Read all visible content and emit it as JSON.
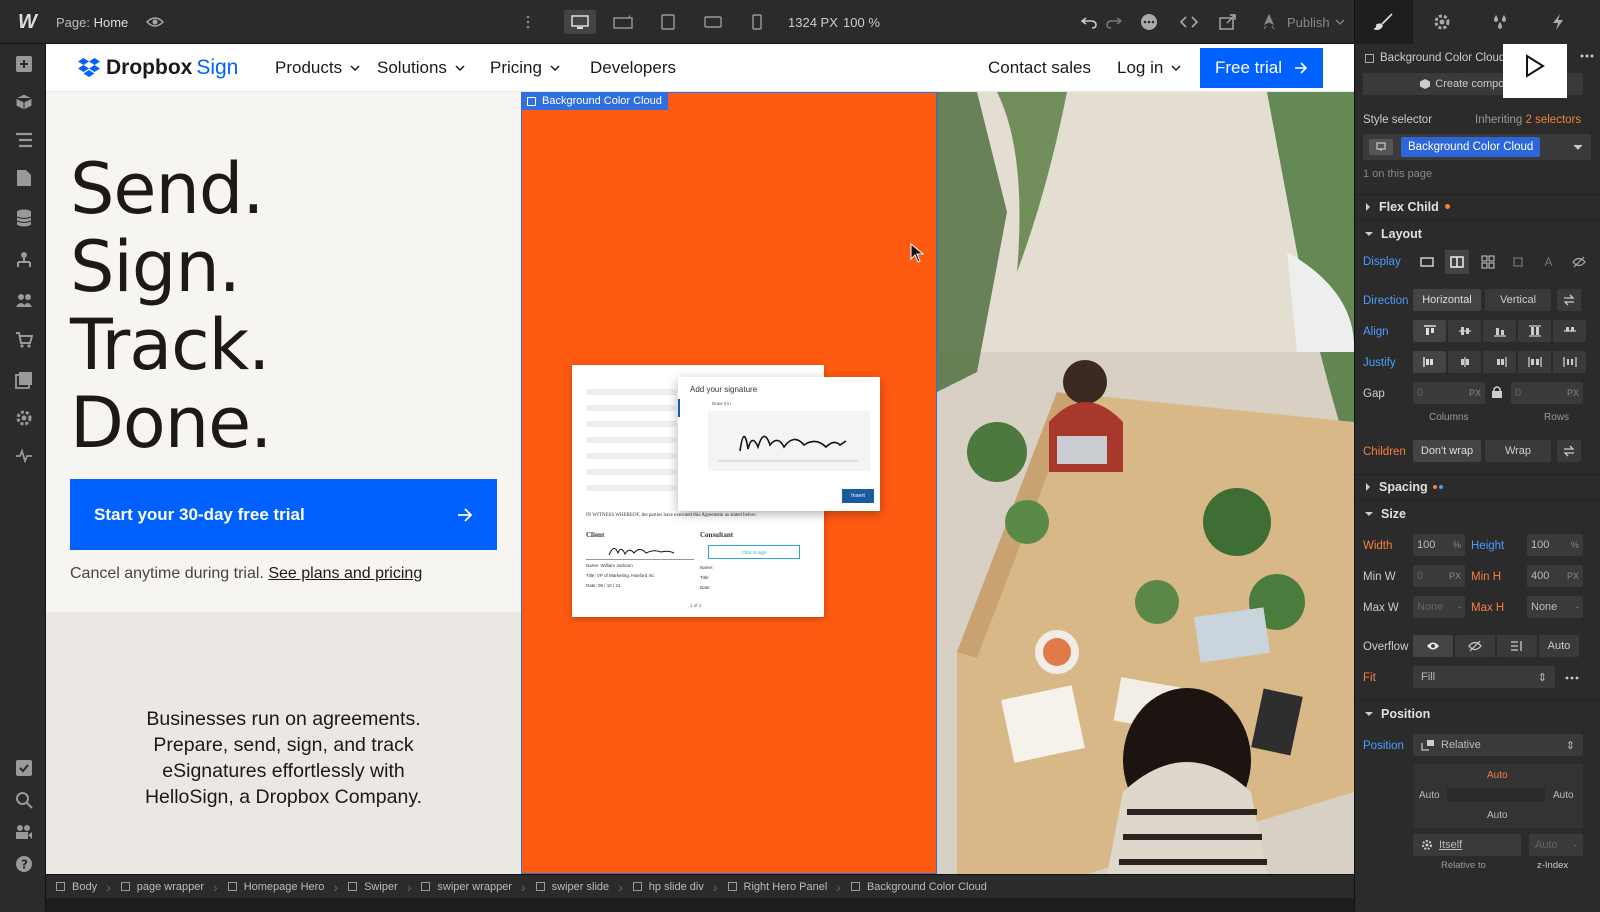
{
  "topbar": {
    "page_label": "Page:",
    "page_name": "Home",
    "width_value": "1324",
    "width_unit": "PX",
    "zoom_value": "100",
    "zoom_unit": "%",
    "publish_label": "Publish"
  },
  "site": {
    "brand_main": "Dropbox",
    "brand_sub": "Sign",
    "nav_items": [
      "Products",
      "Solutions",
      "Pricing",
      "Developers"
    ],
    "contact": "Contact sales",
    "login": "Log in",
    "free_trial": "Free trial",
    "headline": [
      "Send.",
      "Sign.",
      "Track.",
      "Done."
    ],
    "cta_label": "Start your 30-day free trial",
    "cancel_text": "Cancel anytime during trial.",
    "plans_link": "See plans and pricing",
    "body_lines": [
      "Businesses run on agreements.",
      "Prepare, send, sign, and track",
      "eSignatures effortlessly with",
      "HelloSign, a Dropbox Company."
    ],
    "selected_element_tag": "Background Color Cloud"
  },
  "doc_mock": {
    "signature_title": "Add your signature",
    "draw_label": "Draw it in",
    "insert_btn": "Insert",
    "witness": "IN WITNESS WHEREOF, the parties have executed this Agreement as stated below:",
    "client": "Client",
    "consultant": "Consultant",
    "click_to_sign": "Click to sign",
    "client_name": "William Jackson",
    "client_title": "VP of Marketing, Hanford Inc",
    "client_date": "08 / 10 / 21",
    "name_label": "Name:",
    "title_label": "Title:",
    "date_label": "Date:",
    "page_count": "1 of 1"
  },
  "breadcrumb": [
    "Body",
    "page wrapper",
    "Homepage Hero",
    "Swiper",
    "swiper wrapper",
    "swiper slide",
    "hp slide div",
    "Right Hero Panel",
    "Background Color Cloud"
  ],
  "panel": {
    "class_name": "Background Color Cloud",
    "create_component": "Create component",
    "style_selector": "Style selector",
    "inheriting": "Inheriting",
    "selectors_link": "2 selectors",
    "selector_value": "Background Color Cloud",
    "on_page": "1 on this page",
    "flex_child": "Flex Child",
    "layout": "Layout",
    "display": "Display",
    "direction": "Direction",
    "horizontal": "Horizontal",
    "vertical": "Vertical",
    "align": "Align",
    "justify": "Justify",
    "gap": "Gap",
    "gap_cols": "0",
    "gap_rows": "0",
    "px": "PX",
    "columns": "Columns",
    "rows": "Rows",
    "children": "Children",
    "dont_wrap": "Don't wrap",
    "wrap": "Wrap",
    "spacing": "Spacing",
    "size": "Size",
    "width": "Width",
    "width_val": "100",
    "pct": "%",
    "height": "Height",
    "height_val": "100",
    "min_w": "Min W",
    "min_w_val": "0",
    "min_h": "Min H",
    "min_h_val": "400",
    "max_w": "Max W",
    "max_w_val": "None",
    "dash": "-",
    "max_h": "Max H",
    "max_h_val": "None",
    "overflow": "Overflow",
    "auto": "Auto",
    "fit": "Fit",
    "fit_val": "Fill",
    "position_title": "Position",
    "position_label": "Position",
    "position_val": "Relative",
    "pos_top": "Auto",
    "pos_left": "Auto",
    "pos_right": "Auto",
    "pos_bottom": "Auto",
    "itself": "Itself",
    "relative_to": "Relative to",
    "zindex_val": "Auto",
    "zindex": "z-Index"
  },
  "colors": {
    "accent_blue": "#0061fe",
    "hero_orange": "#ff5a12",
    "panel_blue": "#4a9eff",
    "panel_orange": "#f5803e"
  }
}
